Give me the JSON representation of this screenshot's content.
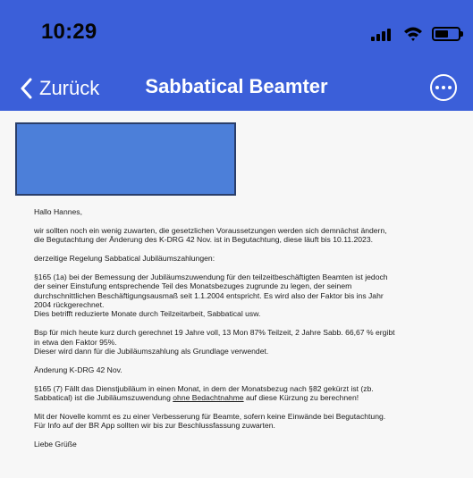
{
  "status_bar": {
    "time": "10:29"
  },
  "nav": {
    "back_label": "Zurück",
    "title": "Sabbatical Beamter"
  },
  "icons": {
    "back": "chevron-left-icon",
    "more": "more-horizontal-circle-icon",
    "signal": "cellular-signal-icon",
    "wifi": "wifi-icon",
    "battery": "battery-icon"
  },
  "colors": {
    "accent": "#3b5fd9",
    "redaction": "#4c7fd9",
    "background": "#f7f7f7"
  },
  "message": {
    "greeting": "Hallo Hannes,",
    "p1_l1": "wir sollten noch ein wenig zuwarten, die gesetzlichen Voraussetzungen werden sich demnächst ändern,",
    "p1_l2": "die Begutachtung der Änderung des K-DRG 42 Nov. ist in Begutachtung, diese läuft bis 10.11.2023.",
    "p2": "derzeitige Regelung Sabbatical Jubiläumszahlungen:",
    "p3_l1": "§165 (1a) bei der Bemessung der Jubiläumszuwendung für den teilzeitbeschäftigten Beamten ist jedoch",
    "p3_l2": "der seiner Einstufung entsprechende Teil des Monatsbezuges zugrunde zu legen, der seinem",
    "p3_l3": "durchschnittlichen Beschäftigungsausmaß seit 1.1.2004 entspricht. Es wird also der Faktor bis ins Jahr",
    "p3_l4": "2004 rückgerechnet.",
    "p3_l5": "Dies betrifft reduzierte Monate durch Teilzeitarbeit, Sabbatical usw.",
    "p4_l1": "Bsp für mich heute kurz durch gerechnet  19 Jahre voll, 13 Mon 87% Teilzeit, 2 Jahre Sabb. 66,67 % ergibt",
    "p4_l2": "in etwa den Faktor 95%.",
    "p4_l3": "Dieser wird dann für die Jubiläumszahlung als Grundlage verwendet.",
    "p5": "Änderung K-DRG 42 Nov.",
    "p6_l1": "§165 (7) Fällt das Dienstjubiläum in einen Monat, in dem der Monatsbezug nach §82 gekürzt ist (zb.",
    "p6_l2_a": "Sabbatical) ist die Jubiläumszuwendung ",
    "p6_l2_u": "ohne Bedachtnahme",
    "p6_l2_b": " auf diese Kürzung zu berechnen!",
    "p7_l1": "Mit der Novelle kommt es zu einer Verbesserung für Beamte, sofern keine Einwände bei Begutachtung.",
    "p7_l2": "Für Info auf der BR App sollten wir bis zur Beschlussfassung zuwarten.",
    "closing": "Liebe Grüße"
  }
}
